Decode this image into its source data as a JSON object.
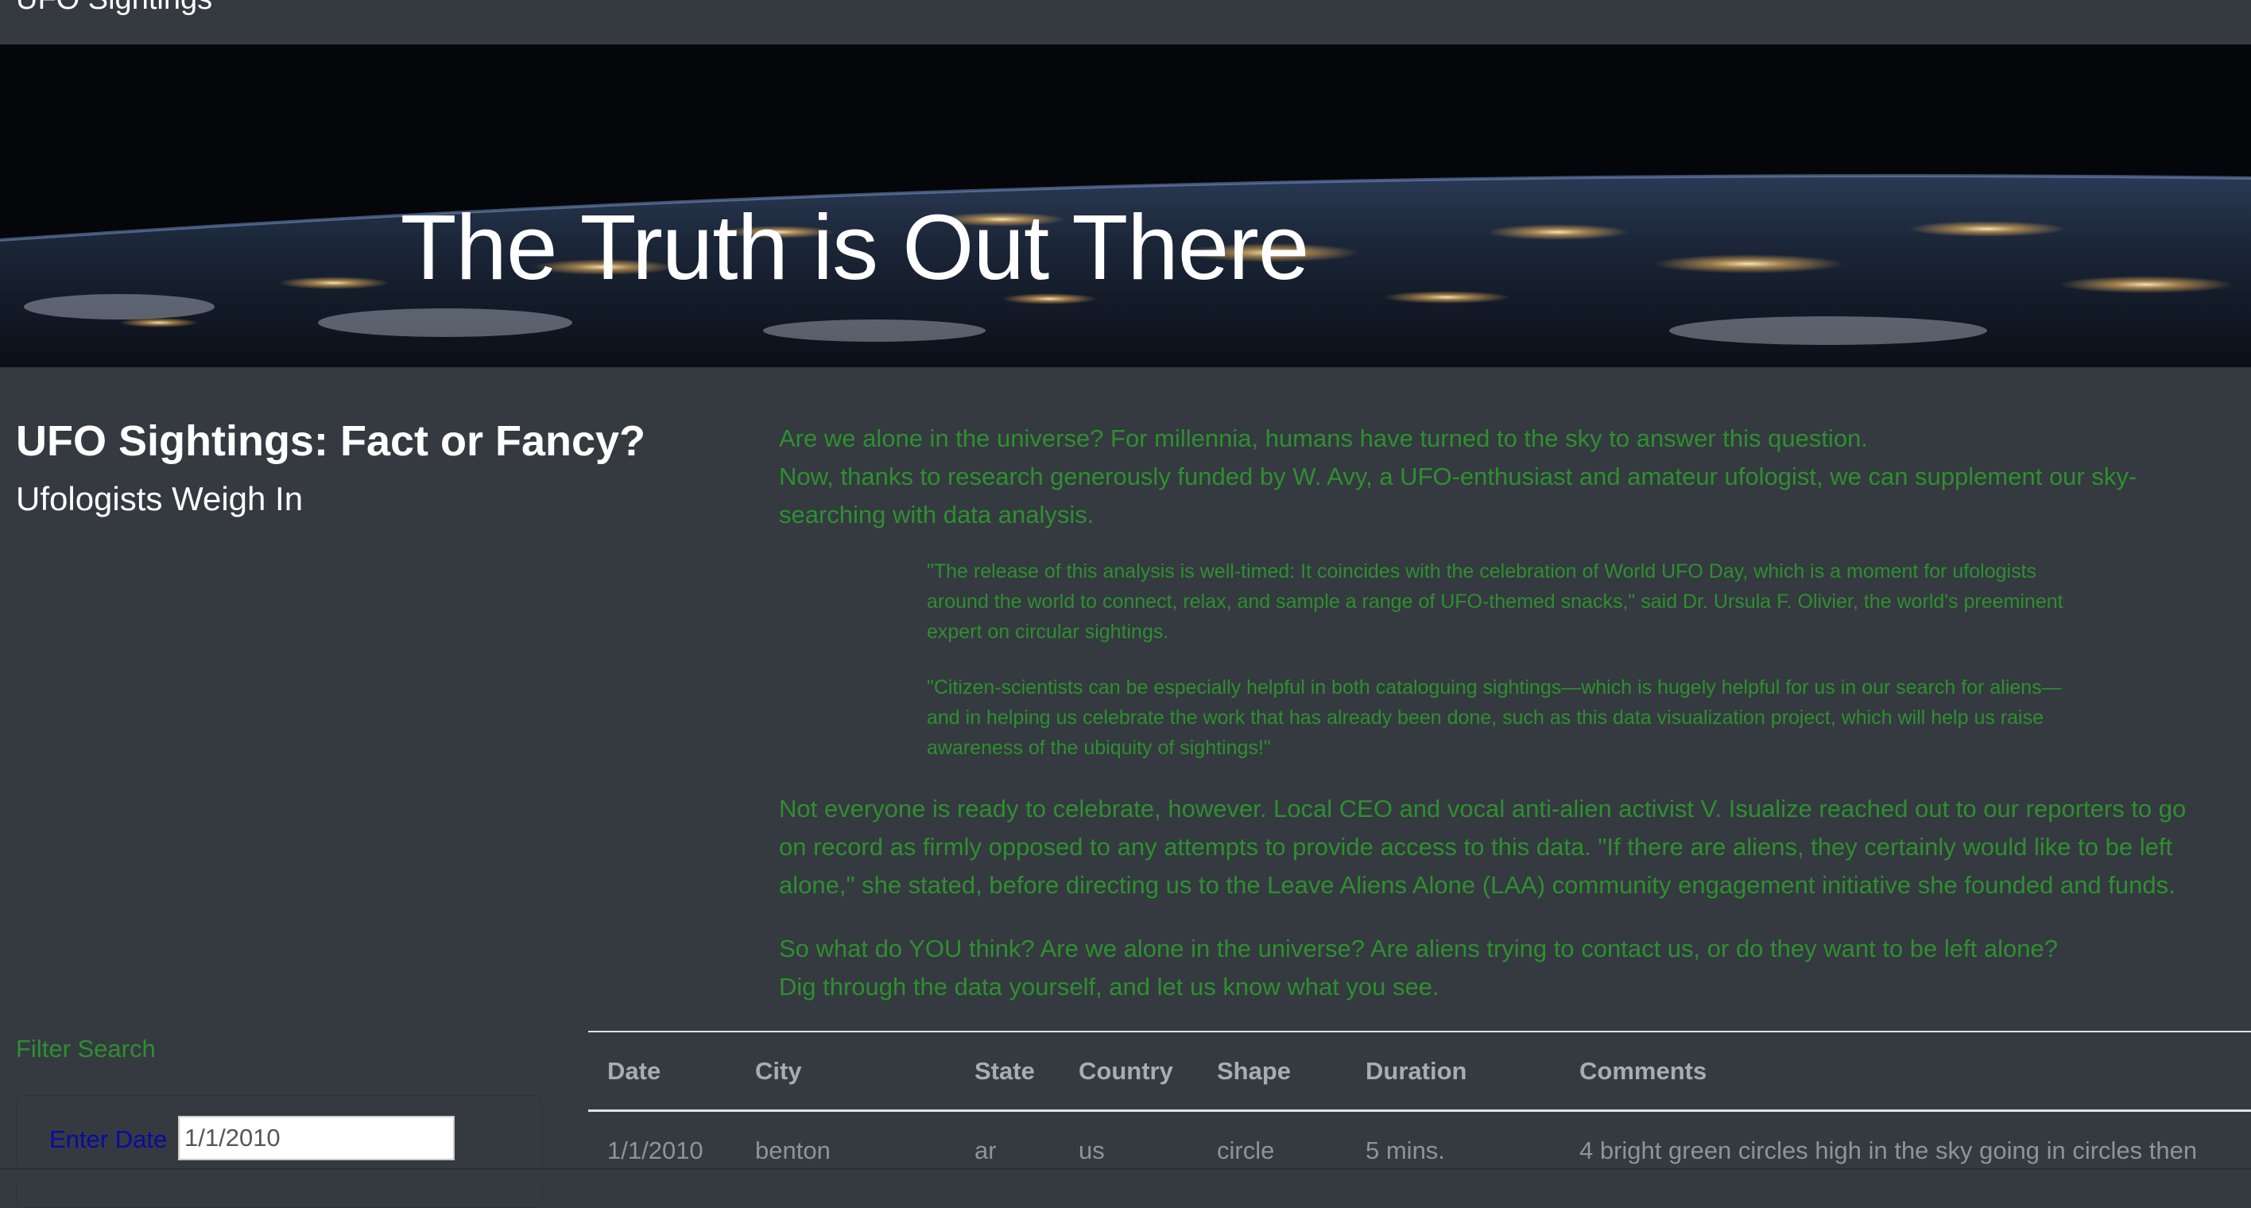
{
  "navbar": {
    "brand": "UFO Sightings"
  },
  "hero": {
    "title": "The Truth is Out There"
  },
  "intro": {
    "title": "UFO Sightings: Fact or Fancy?",
    "subtitle": "Ufologists Weigh In"
  },
  "article": {
    "p1_line1": "Are we alone in the universe? For millennia, humans have turned to the sky to answer this question.",
    "p1_line2": "Now, thanks to research generously funded by W. Avy, a UFO-enthusiast and amateur ufologist, we can supplement our sky-searching with data analysis.",
    "quote1": "\"The release of this analysis is well-timed: It coincides with the celebration of World UFO Day, which is a moment for ufologists around the world to connect, relax, and sample a range of UFO-themed snacks,\" said Dr. Ursula F. Olivier, the world's preeminent expert on circular sightings.",
    "quote2": "\"Citizen-scientists can be especially helpful in both cataloguing sightings—which is hugely helpful for us in our search for aliens—and in helping us celebrate the work that has already been done, such as this data visualization project, which will help us raise awareness of the ubiquity of sightings!\"",
    "p2_line1": "Not everyone is ready to celebrate, however. Local CEO and vocal anti-alien activist V. Isualize reached out to our reporters to go",
    "p2_line2": "on record as firmly opposed to any attempts to provide access to this data. \"If there are aliens, they certainly would like to be left",
    "p2_line3": "alone,\" she stated, before directing us to the Leave Aliens Alone (LAA) community engagement initiative she founded and funds.",
    "p3_line1": "So what do YOU think? Are we alone in the universe? Are aliens trying to contact us, or do they want to be left alone?",
    "p3_line2": "Dig through the data yourself, and let us know what you see."
  },
  "filter": {
    "title": "Filter Search",
    "date_label": "Enter Date",
    "date_value": "1/1/2010"
  },
  "table": {
    "headers": [
      "Date",
      "City",
      "State",
      "Country",
      "Shape",
      "Duration",
      "Comments"
    ],
    "rows": [
      [
        "1/1/2010",
        "benton",
        "ar",
        "us",
        "circle",
        "5 mins.",
        "4 bright green circles high in the sky going in circles then"
      ]
    ]
  },
  "colors": {
    "background": "#343a40",
    "article_text": "#2f8f2f",
    "label_text": "#0a0aa0",
    "heading_text": "#ffffff"
  }
}
